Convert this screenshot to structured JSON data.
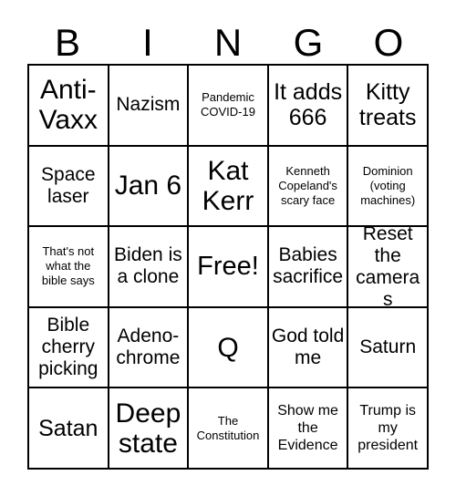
{
  "card": {
    "title": "BINGO",
    "header_letters": [
      "B",
      "I",
      "N",
      "G",
      "O"
    ],
    "colors": {
      "background": "#ffffff",
      "border": "#000000",
      "text": "#000000"
    },
    "grid": {
      "rows": 5,
      "columns": 5,
      "free_space_label": "Free!",
      "free_space_position": "N3"
    },
    "cells": [
      {
        "id": "B1",
        "text": "Anti-Vaxx",
        "size": "xl"
      },
      {
        "id": "I1",
        "text": "Nazism",
        "size": "md"
      },
      {
        "id": "N1",
        "text": "Pandemic COVID-19",
        "size": "xs"
      },
      {
        "id": "G1",
        "text": "It adds 666",
        "size": "lg"
      },
      {
        "id": "O1",
        "text": "Kitty treats",
        "size": "lg"
      },
      {
        "id": "B2",
        "text": "Space laser",
        "size": "md"
      },
      {
        "id": "I2",
        "text": "Jan 6",
        "size": "xl"
      },
      {
        "id": "N2",
        "text": "Kat Kerr",
        "size": "xl"
      },
      {
        "id": "G2",
        "text": "Kenneth Copeland's scary face",
        "size": "xs"
      },
      {
        "id": "O2",
        "text": "Dominion (voting machines)",
        "size": "xs"
      },
      {
        "id": "B3",
        "text": "That's not what the bible says",
        "size": "xs"
      },
      {
        "id": "I3",
        "text": "Biden is a clone",
        "size": "md"
      },
      {
        "id": "N3",
        "text": "Free!",
        "size": "free"
      },
      {
        "id": "G3",
        "text": "Babies sacrifice",
        "size": "md"
      },
      {
        "id": "O3",
        "text": "Reset the cameras",
        "size": "md"
      },
      {
        "id": "B4",
        "text": "Bible cherry picking",
        "size": "md"
      },
      {
        "id": "I4",
        "text": "Adeno-chrome",
        "size": "md"
      },
      {
        "id": "N4",
        "text": "Q",
        "size": "xl"
      },
      {
        "id": "G4",
        "text": "God told me",
        "size": "md"
      },
      {
        "id": "O4",
        "text": "Saturn",
        "size": "md"
      },
      {
        "id": "B5",
        "text": "Satan",
        "size": "lg"
      },
      {
        "id": "I5",
        "text": "Deep state",
        "size": "xl"
      },
      {
        "id": "N5",
        "text": "The Constitution",
        "size": "xs"
      },
      {
        "id": "G5",
        "text": "Show me the Evidence",
        "size": "sm"
      },
      {
        "id": "O5",
        "text": "Trump is my president",
        "size": "sm"
      }
    ]
  }
}
